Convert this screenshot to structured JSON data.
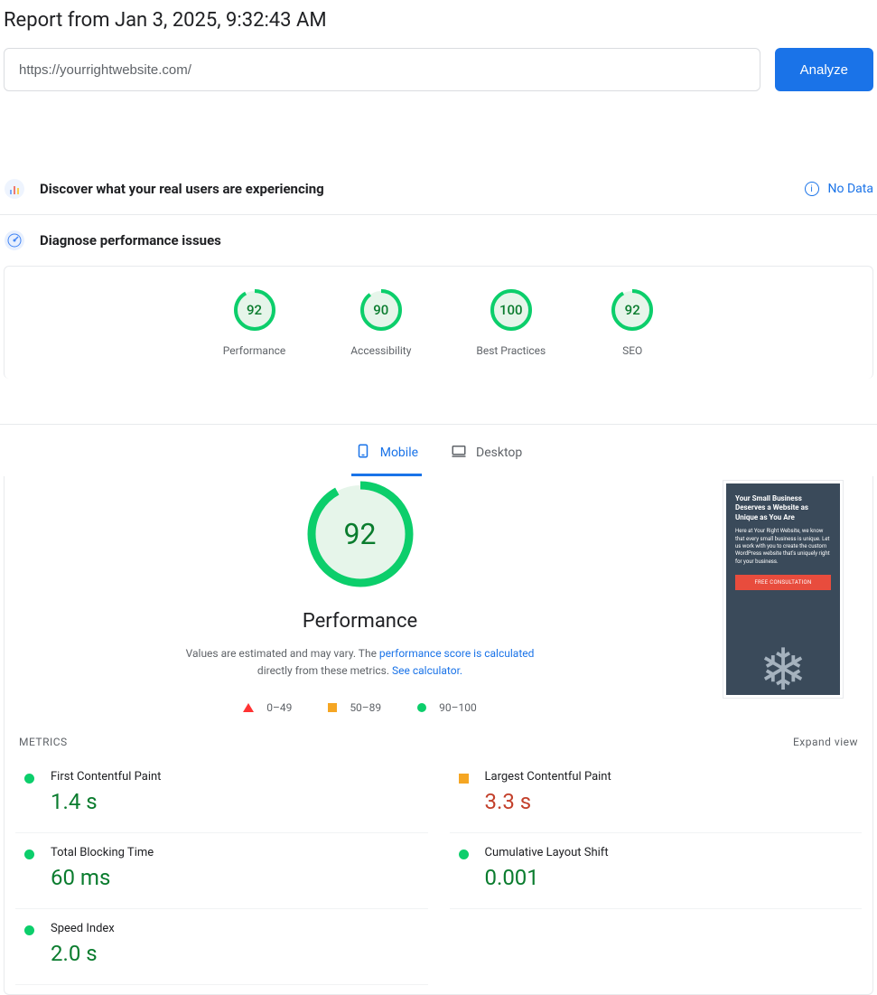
{
  "header": {
    "title": "Report from Jan 3, 2025, 9:32:43 AM",
    "url_value": "https://yourrightwebsite.com/",
    "analyze_label": "Analyze"
  },
  "discover": {
    "title": "Discover what your real users are experiencing",
    "no_data_label": "No Data"
  },
  "diagnose": {
    "title": "Diagnose performance issues"
  },
  "gauges": [
    {
      "score": "92",
      "label": "Performance",
      "pct": 92
    },
    {
      "score": "90",
      "label": "Accessibility",
      "pct": 90
    },
    {
      "score": "100",
      "label": "Best Practices",
      "pct": 100
    },
    {
      "score": "92",
      "label": "SEO",
      "pct": 92
    }
  ],
  "tabs": {
    "mobile": "Mobile",
    "desktop": "Desktop"
  },
  "performance": {
    "score": "92",
    "pct": 92,
    "name": "Performance",
    "desc_pre": "Values are estimated and may vary. The ",
    "desc_link1": "performance score is calculated",
    "desc_mid": " directly from these metrics. ",
    "desc_link2": "See calculator."
  },
  "legend": {
    "low": "0–49",
    "mid": "50–89",
    "high": "90–100"
  },
  "thumbnail": {
    "heading": "Your Small Business Deserves a Website as Unique as You Are",
    "body": "Here at Your Right Website, we know that every small business is unique. Let us work with you to create the custom WordPress website that's uniquely right for your business.",
    "button": "FREE CONSULTATION"
  },
  "metrics_header": {
    "label": "METRICS",
    "expand": "Expand view"
  },
  "metrics": [
    {
      "name": "First Contentful Paint",
      "value": "1.4 s",
      "status": "green"
    },
    {
      "name": "Largest Contentful Paint",
      "value": "3.3 s",
      "status": "orange"
    },
    {
      "name": "Total Blocking Time",
      "value": "60 ms",
      "status": "green"
    },
    {
      "name": "Cumulative Layout Shift",
      "value": "0.001",
      "status": "green"
    },
    {
      "name": "Speed Index",
      "value": "2.0 s",
      "status": "green"
    }
  ],
  "colors": {
    "green": "#0cce6b",
    "green_dark": "#0a7c2e",
    "green_bg": "#e6f5ea",
    "orange": "#f5a623",
    "red": "#f33",
    "blue": "#1a73e8"
  }
}
